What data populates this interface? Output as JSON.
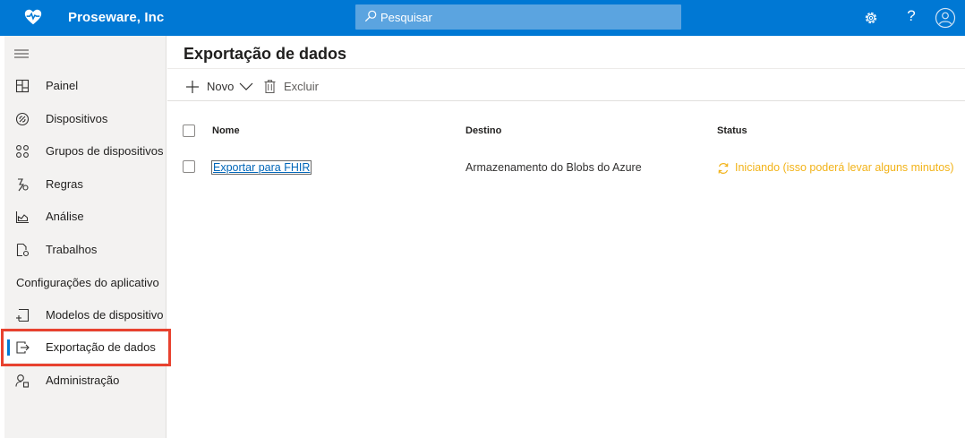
{
  "topbar": {
    "brand": "Proseware, Inc",
    "search_placeholder": "Pesquisar",
    "help_label": "?"
  },
  "sidebar": {
    "items": [
      {
        "label": "Painel",
        "icon": "dashboard-icon"
      },
      {
        "label": "Dispositivos",
        "icon": "devices-icon"
      },
      {
        "label": "Grupos de dispositivos",
        "icon": "device-groups-icon"
      },
      {
        "label": "Regras",
        "icon": "rules-icon"
      },
      {
        "label": "Análise",
        "icon": "analytics-icon"
      },
      {
        "label": "Trabalhos",
        "icon": "jobs-icon"
      }
    ],
    "section_title": "Configurações do aplicativo",
    "app_items": [
      {
        "label": "Modelos de dispositivo",
        "icon": "device-templates-icon"
      },
      {
        "label": "Exportação de dados",
        "icon": "data-export-icon",
        "active": true
      },
      {
        "label": "Administração",
        "icon": "administration-icon"
      }
    ]
  },
  "main": {
    "title": "Exportação de dados",
    "commands": {
      "new_label": "Novo",
      "delete_label": "Excluir"
    },
    "table": {
      "columns": [
        "Nome",
        "Destino",
        "Status"
      ],
      "rows": [
        {
          "name": "Exportar para FHIR",
          "destination": "Armazenamento do Blobs do Azure",
          "status": "Iniciando (isso poderá levar alguns minutos)"
        }
      ]
    }
  },
  "colors": {
    "accent": "#0078d4",
    "status_pending": "#f2b319",
    "highlight": "#e8422f",
    "link": "#0066b8"
  }
}
